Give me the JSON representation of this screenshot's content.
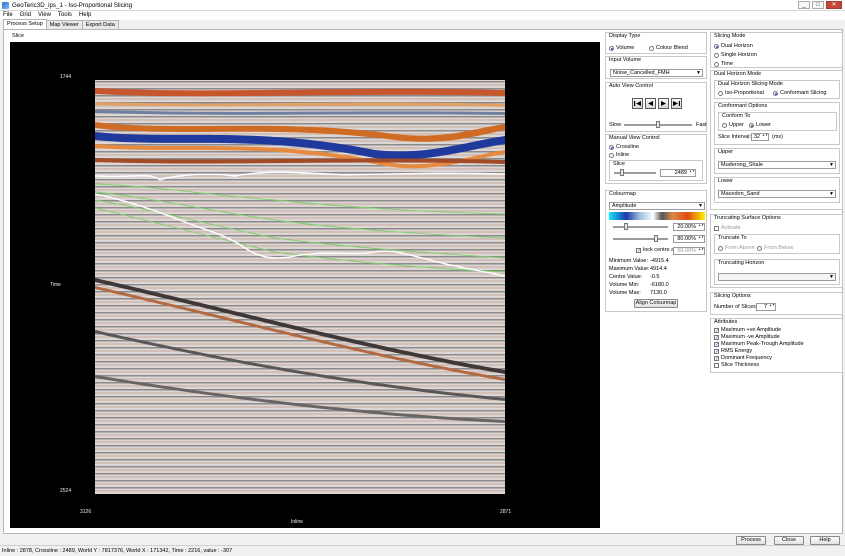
{
  "window": {
    "title": "GeoTeric3D_ips_1 - Iso-Proportional Slicing",
    "buttons": {
      "minimize": "_",
      "maximize": "□",
      "close": "✕"
    }
  },
  "menu": [
    "File",
    "Grid",
    "View",
    "Tools",
    "Help"
  ],
  "tabs": [
    "Process Setup",
    "Map Viewer",
    "Export Data"
  ],
  "slice": {
    "label": "Slice",
    "y_top": "1744",
    "y_bottom": "2524",
    "y_axis": "Time",
    "x_left": "3126",
    "x_right": "2871",
    "x_axis": "Inline"
  },
  "display_type": {
    "title": "Display Type",
    "options": [
      "Volume",
      "Colour Blend"
    ],
    "selected": "Volume"
  },
  "input_volume": {
    "title": "Input Volume",
    "value": "Noise_Cancelled_FMH"
  },
  "auto_view": {
    "title": "Auto View Control",
    "slow": "Slow",
    "fast": "Fast"
  },
  "manual_view": {
    "title": "Manual View Control",
    "options": [
      "Crossline",
      "Inline"
    ],
    "selected": "Crossline",
    "slice_label": "Slice",
    "slice_value": "2489"
  },
  "colourmap": {
    "title": "Colourmap",
    "value": "Amplitude",
    "low_pct": "20.00%",
    "high_pct": "80.00%",
    "lock_label": "lock centre at",
    "lock_pct": "50.00%",
    "stats": [
      {
        "label": "Minimum Value:",
        "value": "-4915.4"
      },
      {
        "label": "Maximum Value:",
        "value": "4914.4"
      },
      {
        "label": "Centre Value:",
        "value": "-0.5"
      },
      {
        "label": "Volume Min:",
        "value": "-6180.0"
      },
      {
        "label": "Volume Max:",
        "value": "7130.0"
      }
    ],
    "align_button": "Align Colourmap"
  },
  "slicing_mode": {
    "title": "Slicing Mode",
    "options": [
      "Dual Horizon",
      "Single Horizon",
      "Time"
    ],
    "selected": "Dual Horizon"
  },
  "dual_horizon": {
    "title": "Dual Horizon Mode",
    "slicing_mode_title": "Dual Horizon Slicing Mode",
    "options": [
      "Iso-Proportional",
      "Conformant Slicing"
    ],
    "selected": "Conformant Slicing",
    "conformant_title": "Conformant Options",
    "conform_to_title": "Conform To",
    "conform_options": [
      "Upper",
      "Lower"
    ],
    "conform_selected": "Lower",
    "slice_interval_label": "Slice Interval:",
    "slice_interval_value": "32",
    "slice_interval_unit": "(ms)",
    "upper_title": "Upper",
    "upper_value": "Muderong_Shale",
    "lower_title": "Lower",
    "lower_value": "Macedon_Sand"
  },
  "truncating": {
    "title": "Truncating Surface Options",
    "activate": "Activate",
    "truncate_to": "Truncate To",
    "options": [
      "From Above",
      "From Below"
    ],
    "horizon_title": "Truncating Horizon",
    "horizon_value": ""
  },
  "slicing_options": {
    "title": "Slicing Options",
    "num_slices_label": "Number of Slices:",
    "num_slices_value": "7"
  },
  "attributes": {
    "title": "Attributes",
    "items": [
      {
        "label": "Maximum +ve Amplitude",
        "checked": true
      },
      {
        "label": "Maximum -ve Amplitude",
        "checked": true
      },
      {
        "label": "Maximum Peak-Trough Amplitude",
        "checked": true
      },
      {
        "label": "RMS Energy",
        "checked": true
      },
      {
        "label": "Dominant Frequency",
        "checked": true
      },
      {
        "label": "Slice Thickness",
        "checked": false
      }
    ]
  },
  "footer_buttons": [
    "Process",
    "Close",
    "Help"
  ],
  "status": "Inline : 2878, Crossline : 2489, World Y : 7817376, World X : 171342, Time : 2216, value : -307",
  "colors": {
    "accent": "#1b52b5",
    "horizon_white": "#ffffff",
    "horizon_green": "#7cd36a"
  }
}
